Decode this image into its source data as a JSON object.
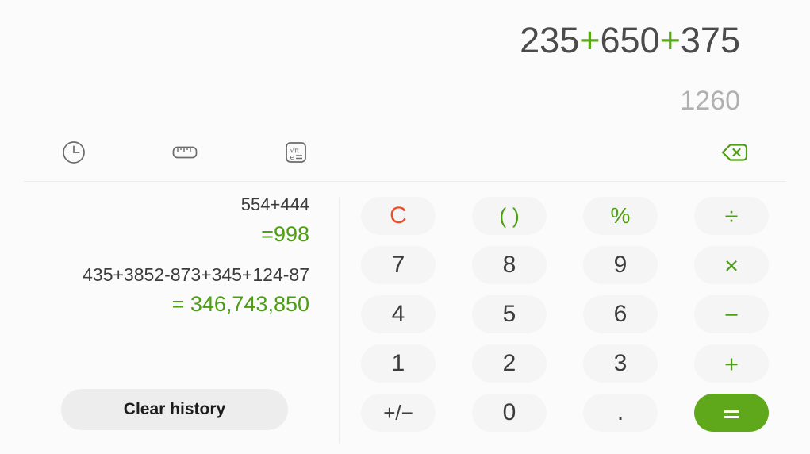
{
  "display": {
    "expression_parts": [
      {
        "text": "235",
        "type": "number"
      },
      {
        "text": "+",
        "type": "operator"
      },
      {
        "text": "650",
        "type": "number"
      },
      {
        "text": "+",
        "type": "operator"
      },
      {
        "text": "375",
        "type": "number"
      }
    ],
    "expression_text": "235+650+375",
    "preview_result": "1260"
  },
  "toolbar": {
    "history_icon": "clock-icon",
    "converter_icon": "ruler-icon",
    "scientific_icon": "scientific-calculator-icon",
    "backspace_icon": "backspace-icon"
  },
  "history": {
    "items": [
      {
        "expression": "554+444",
        "result": "=998"
      },
      {
        "expression": "435+3852-873+345+124-87",
        "result": "= 346,743,850"
      }
    ],
    "clear_label": "Clear history"
  },
  "keypad": {
    "keys": [
      {
        "label": "C",
        "name": "clear-key",
        "style": "clear"
      },
      {
        "label": "( )",
        "name": "parentheses-key",
        "style": "paren"
      },
      {
        "label": "%",
        "name": "percent-key",
        "style": "pct"
      },
      {
        "label": "÷",
        "name": "divide-key",
        "style": "op"
      },
      {
        "label": "7",
        "name": "digit-7-key",
        "style": "digit"
      },
      {
        "label": "8",
        "name": "digit-8-key",
        "style": "digit"
      },
      {
        "label": "9",
        "name": "digit-9-key",
        "style": "digit"
      },
      {
        "label": "×",
        "name": "multiply-key",
        "style": "op"
      },
      {
        "label": "4",
        "name": "digit-4-key",
        "style": "digit"
      },
      {
        "label": "5",
        "name": "digit-5-key",
        "style": "digit"
      },
      {
        "label": "6",
        "name": "digit-6-key",
        "style": "digit"
      },
      {
        "label": "−",
        "name": "subtract-key",
        "style": "op"
      },
      {
        "label": "1",
        "name": "digit-1-key",
        "style": "digit"
      },
      {
        "label": "2",
        "name": "digit-2-key",
        "style": "digit"
      },
      {
        "label": "3",
        "name": "digit-3-key",
        "style": "digit"
      },
      {
        "label": "+",
        "name": "add-key",
        "style": "op"
      },
      {
        "label": "+/−",
        "name": "sign-toggle-key",
        "style": "sign"
      },
      {
        "label": "0",
        "name": "digit-0-key",
        "style": "digit"
      },
      {
        "label": ".",
        "name": "decimal-point-key",
        "style": "dot"
      },
      {
        "label": "=",
        "name": "equals-key",
        "style": "equals"
      }
    ]
  },
  "colors": {
    "accent_green": "#4d9e12",
    "equals_green": "#5fa81b",
    "clear_red": "#e8522c",
    "key_bg": "#f5f5f5",
    "page_bg": "#fbfbfb",
    "text_dark": "#3d3d3d",
    "text_muted": "#b0b0b0"
  }
}
